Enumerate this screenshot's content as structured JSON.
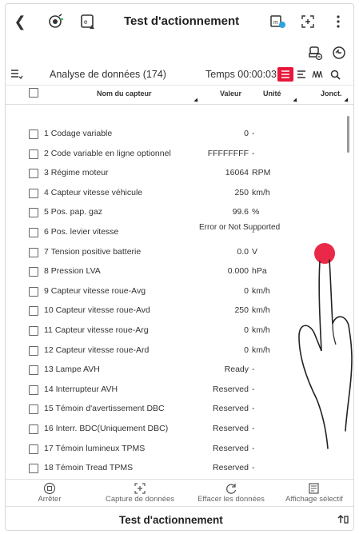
{
  "header": {
    "back_icon": "chevron-left-icon",
    "title": "Test d'actionnement",
    "left_icons": [
      "vehicle-connect-icon",
      "screenshot-upload-icon"
    ],
    "right_icons": [
      "chip-icon",
      "expand-icon",
      "more-vertical-icon"
    ]
  },
  "toolbar": {
    "icons": [
      "car-settings-icon",
      "ev-icon"
    ]
  },
  "analysis": {
    "label": "Analyse de données (174)",
    "timer": "Temps 00:00:03",
    "view_toggle_active": "list",
    "accent_color": "#e8173a"
  },
  "columns": {
    "name": "Nom du capteur",
    "value": "Valeur",
    "unit": "Unité",
    "join": "Jonct."
  },
  "rows": [
    {
      "name": "1 Codage variable",
      "value": "0",
      "unit": "-"
    },
    {
      "name": "2 Code variable en ligne optionnel",
      "value": "FFFFFFFF",
      "unit": "-"
    },
    {
      "name": "3 Régime moteur",
      "value": "16064",
      "unit": "RPM"
    },
    {
      "name": "4 Capteur vitesse véhicule",
      "value": "250",
      "unit": "km/h"
    },
    {
      "name": "5 Pos. pap. gaz",
      "value": "99.6",
      "unit": "%"
    },
    {
      "name": "6 Pos. levier vitesse",
      "value": "Error or Not Supported",
      "unit": "-"
    },
    {
      "name": "7 Tension positive batterie",
      "value": "0.0",
      "unit": "V"
    },
    {
      "name": "8 Pression LVA",
      "value": "0.000",
      "unit": "hPa"
    },
    {
      "name": "9 Capteur vitesse roue-Avg",
      "value": "0",
      "unit": "km/h"
    },
    {
      "name": "10 Capteur vitesse roue-Avd",
      "value": "250",
      "unit": "km/h"
    },
    {
      "name": "11 Capteur vitesse roue-Arg",
      "value": "0",
      "unit": "km/h"
    },
    {
      "name": "12 Capteur vitesse roue-Ard",
      "value": "0",
      "unit": "km/h"
    },
    {
      "name": "13 Lampe AVH",
      "value": "Ready",
      "unit": "-"
    },
    {
      "name": "14 Interrupteur AVH",
      "value": "Reserved",
      "unit": "-"
    },
    {
      "name": "15 Témoin d'avertissement DBC",
      "value": "Reserved",
      "unit": "-"
    },
    {
      "name": "16 Interr. BDC(Uniquement DBC)",
      "value": "Reserved",
      "unit": "-"
    },
    {
      "name": "17 Témoin lumineux TPMS",
      "value": "Reserved",
      "unit": "-"
    },
    {
      "name": "18 Témoin Tread TPMS",
      "value": "Reserved",
      "unit": "-"
    }
  ],
  "bottom_actions": [
    {
      "label": "Arrêter",
      "icon": "stop-icon"
    },
    {
      "label": "Capture de données",
      "icon": "capture-icon"
    },
    {
      "label": "Effacer les données",
      "icon": "refresh-icon"
    },
    {
      "label": "Affichage sélectif",
      "icon": "filter-list-icon"
    }
  ],
  "footer": {
    "title": "Test d'actionnement",
    "icon": "pin-toggle-icon"
  },
  "overlay": {
    "gesture": "tap-hand-icon"
  }
}
